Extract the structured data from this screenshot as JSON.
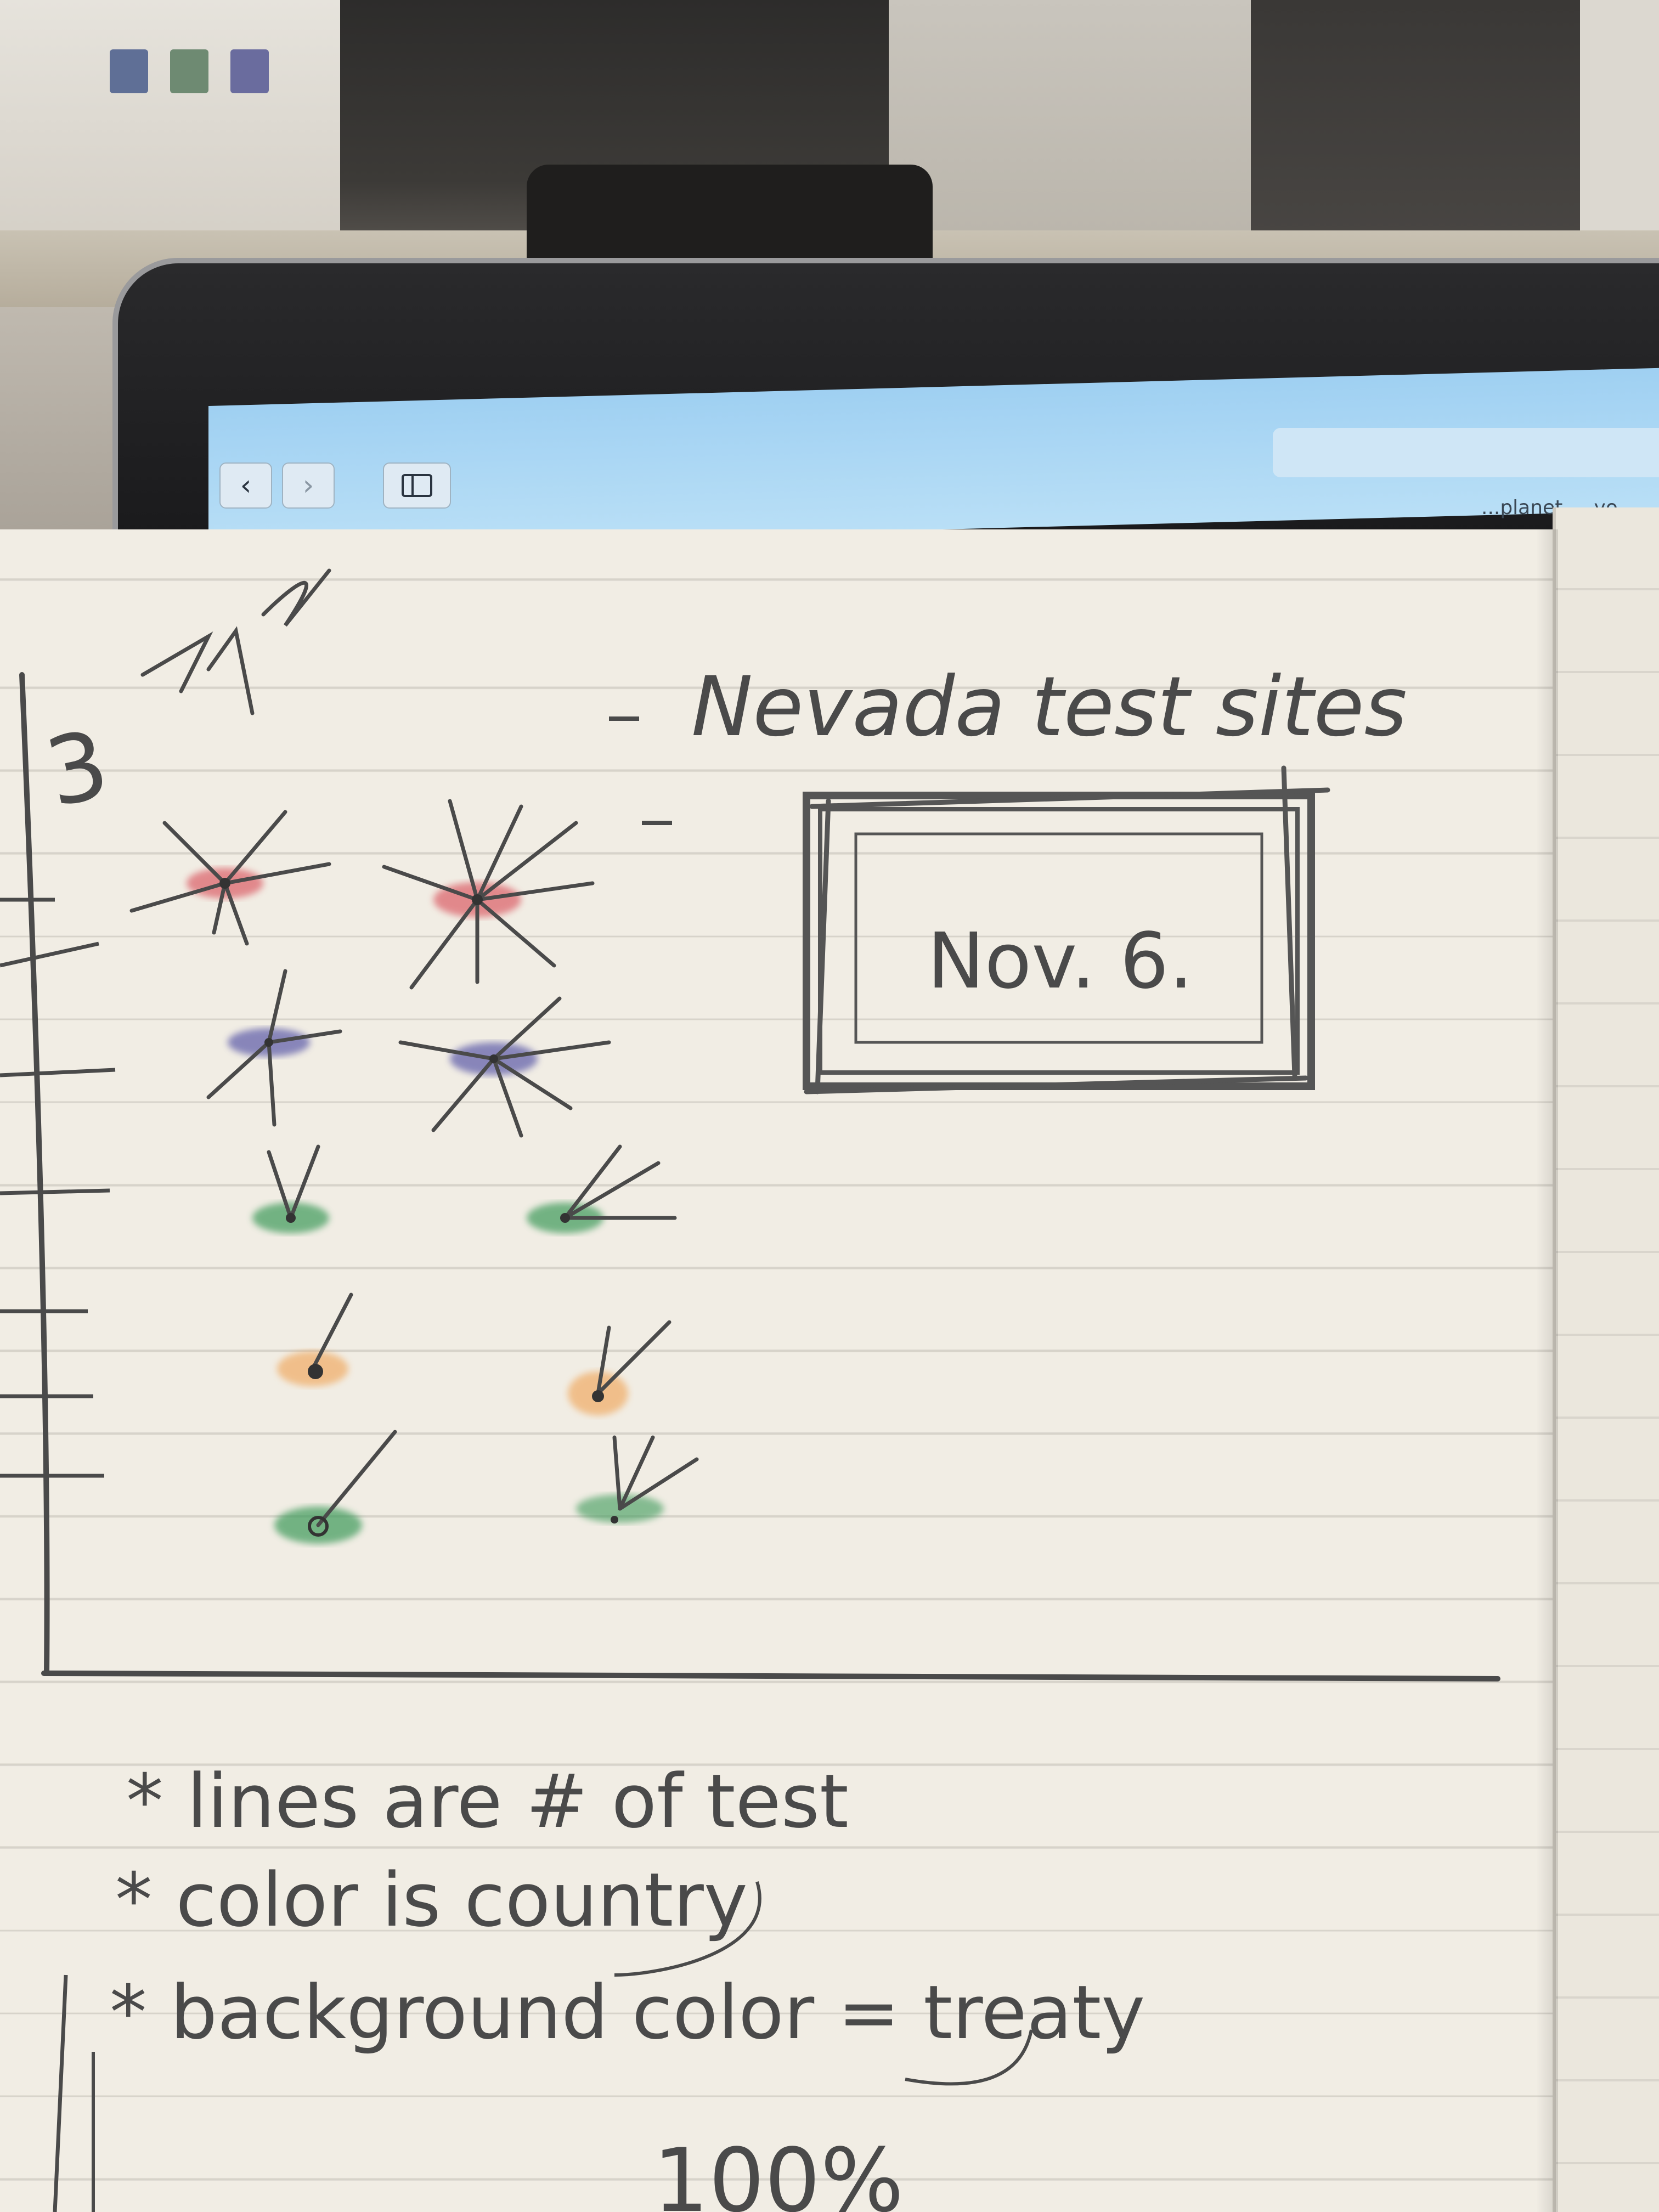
{
  "sketch": {
    "title": "Nevada test sites",
    "date_box": "Nov. 6.",
    "corner_mark": "3",
    "legend": [
      "* lines are # of test",
      "* color is country",
      "* background color = treaty"
    ],
    "footer": "100%",
    "colors": {
      "red": "#d9535d",
      "blue": "#5b5aa8",
      "green": "#3d9a5a",
      "orange": "#f0a050",
      "pencil": "#4a4a4a"
    }
  },
  "browser": {
    "back_icon": "chevron-left-icon",
    "forward_icon": "chevron-right-icon",
    "sidebar_icon": "sidebar-icon",
    "back_glyph": "‹",
    "forward_glyph": "›",
    "tab_hint": "...planet ... yo..."
  }
}
